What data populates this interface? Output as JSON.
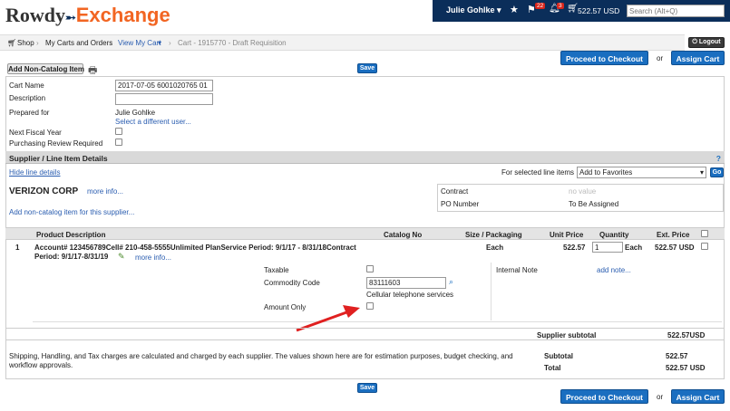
{
  "app": {
    "logo_part1": "Rowdy",
    "logo_part2": "Exchange",
    "user_name": "Julie Gohlke",
    "notifications_flag_count": "22",
    "notifications_bell_count": "3",
    "cart_total": "522.57 USD",
    "search_placeholder": "Search (Alt+Q)",
    "logout_label": "Logout"
  },
  "breadcrumb": {
    "shop": "Shop",
    "my_carts": "My Carts and Orders",
    "view_my_cart": "View My Cart",
    "current": "Cart - 1915770 - Draft Requisition"
  },
  "actions": {
    "proceed_checkout": "Proceed to Checkout",
    "or": "or",
    "assign_cart": "Assign Cart",
    "add_non_catalog": "Add Non-Catalog Item",
    "save": "Save"
  },
  "cart_form": {
    "cart_name_label": "Cart Name",
    "cart_name_value": "2017-07-05 6001020765 01",
    "description_label": "Description",
    "description_value": "",
    "prepared_for_label": "Prepared for",
    "prepared_for_value": "Julie Gohlke",
    "select_user_link": "Select a different user...",
    "next_fiscal_label": "Next Fiscal Year",
    "purchasing_review_label": "Purchasing Review Required"
  },
  "supplier_section": {
    "header": "Supplier / Line Item Details",
    "help": "?",
    "hide_details_link": "Hide line details",
    "selected_items_label": "For selected line items",
    "selected_items_option": "Add to Favorites",
    "go_button": "Go",
    "supplier_name": "VERIZON CORP",
    "more_info": "more info...",
    "add_item_link": "Add non-catalog item for this supplier...",
    "contract_label": "Contract",
    "contract_value": "no value",
    "po_number_label": "PO Number",
    "po_number_value": "To Be Assigned"
  },
  "table": {
    "headers": {
      "product": "Product Description",
      "catalog": "Catalog No",
      "size": "Size / Packaging",
      "unit_price": "Unit Price",
      "quantity": "Quantity",
      "ext_price": "Ext. Price"
    },
    "line": {
      "number": "1",
      "description_1": "Account# 123456789Cell# 210-458-5555Unlimited PlanService Period: 9/1/17 - 8/31/18Contract",
      "description_2": "Period: 9/1/17-8/31/19",
      "more_info": "more info...",
      "size": "Each",
      "unit_price": "522.57",
      "quantity": "1",
      "qty_unit": "Each",
      "ext_price": "522.57 USD"
    },
    "details": {
      "taxable_label": "Taxable",
      "commodity_label": "Commodity Code",
      "commodity_value": "83111603",
      "commodity_desc": "Cellular telephone services",
      "amount_only_label": "Amount Only",
      "internal_note_label": "Internal Note",
      "add_note_link": "add note..."
    }
  },
  "totals": {
    "supplier_subtotal_label": "Supplier subtotal",
    "supplier_subtotal_value": "522.57USD",
    "disclaimer": "Shipping, Handling, and Tax charges are calculated and charged by each supplier. The values shown here are for estimation purposes, budget checking, and workflow approvals.",
    "subtotal_label": "Subtotal",
    "subtotal_value": "522.57",
    "total_label": "Total",
    "total_value": "522.57 USD"
  },
  "colors": {
    "brand_orange": "#f26522",
    "nav_navy": "#0b2e5a",
    "button_blue": "#1a6ec0",
    "annotation_arrow": "#e02020"
  }
}
